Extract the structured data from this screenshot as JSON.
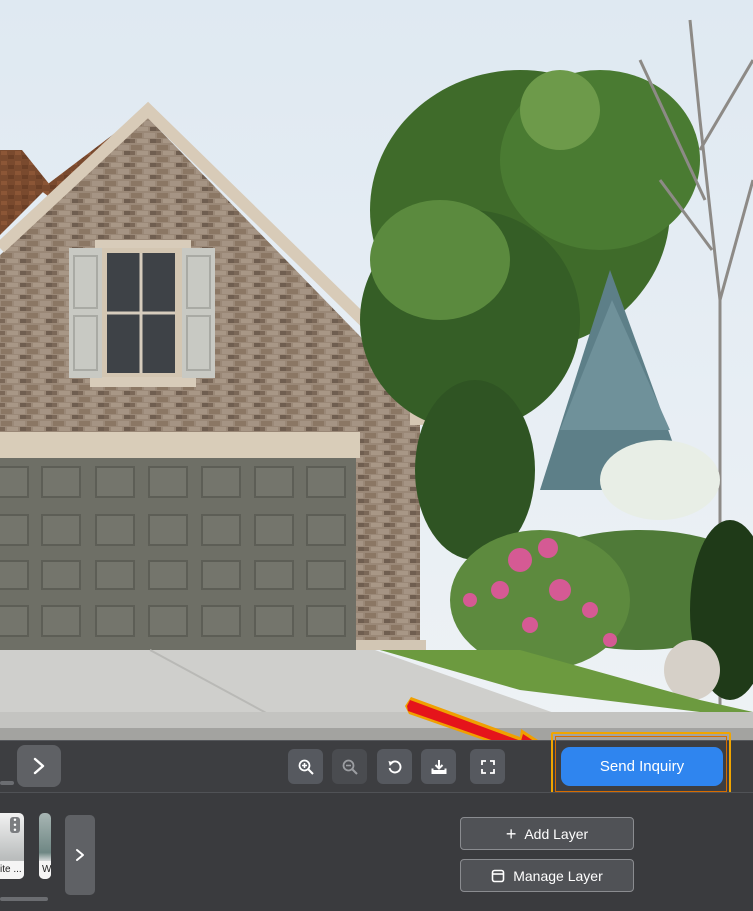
{
  "toolbar": {
    "send_label": "Send Inquiry",
    "tools": [
      {
        "icon": "zoom-in-icon"
      },
      {
        "icon": "zoom-out-icon"
      },
      {
        "icon": "reset-icon"
      },
      {
        "icon": "download-icon"
      },
      {
        "icon": "fullscreen-icon"
      }
    ]
  },
  "panel": {
    "swatches": [
      {
        "caption": "ite ..."
      },
      {
        "caption": "W"
      }
    ],
    "add_layer_label": "Add Layer",
    "manage_layer_label": "Manage Layer"
  },
  "colors": {
    "accent": "#2f85ef",
    "highlight": "#f0a500",
    "arrow": "#e5141b",
    "toolbar_bg": "#3d3e41"
  }
}
